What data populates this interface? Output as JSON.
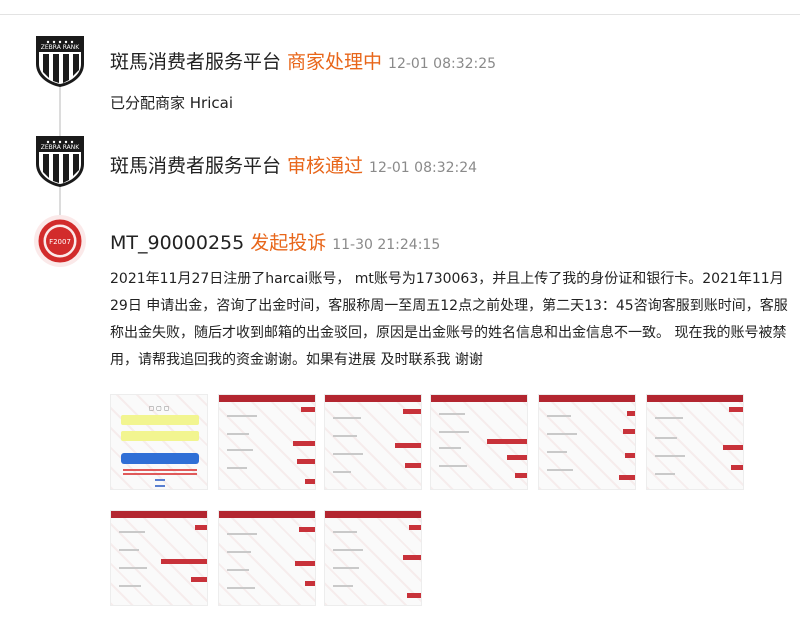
{
  "timeline": [
    {
      "avatar_icon": "zebra-rank-shield-icon",
      "avatar_text": "ZEBRA RANK",
      "name": "斑馬消费者服务平台",
      "status": "商家处理中",
      "time": "12-01 08:32:25",
      "message": "已分配商家 Hricai"
    },
    {
      "avatar_icon": "zebra-rank-shield-icon",
      "avatar_text": "ZEBRA RANK",
      "name": "斑馬消费者服务平台",
      "status": "审核通过",
      "time": "12-01 08:32:24"
    },
    {
      "avatar_icon": "red-circle-avatar-icon",
      "avatar_text": "F2007",
      "name": "MT_90000255",
      "status": "发起投诉",
      "time": "11-30 21:24:15",
      "message": "2021年11月27日注册了harcai账号， mt账号为1730063，并且上传了我的身份证和银行卡。2021年11月29日 申请出金，咨询了出金时间，客服称周一至周五12点之前处理，第二天13：45咨询客服到账时间，客服称出金失败，随后才收到邮箱的出金驳回，原因是出金账号的姓名信息和出金信息不一致。 现在我的账号被禁用，请帮我追回我的资金谢谢。如果有进展 及时联系我 谢谢"
    }
  ],
  "colors": {
    "status": "#e8661a",
    "time": "#8a8a8a",
    "thumb_accent": "#b32630"
  },
  "attachments": [
    {
      "kind": "login-screenshot"
    },
    {
      "kind": "chat-screenshot"
    },
    {
      "kind": "chat-screenshot"
    },
    {
      "kind": "chat-screenshot"
    },
    {
      "kind": "chat-screenshot"
    },
    {
      "kind": "chat-screenshot"
    },
    {
      "kind": "chat-screenshot"
    },
    {
      "kind": "chat-screenshot"
    },
    {
      "kind": "chat-screenshot"
    }
  ]
}
